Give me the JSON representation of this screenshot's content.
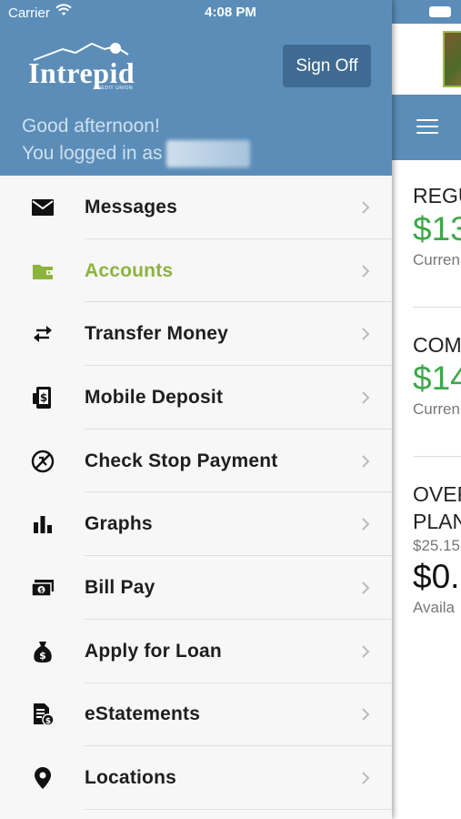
{
  "status_bar": {
    "carrier": "Carrier",
    "time": "4:08 PM"
  },
  "header": {
    "logo_text": "Intrepid",
    "logo_subtext": "CREDIT UNION",
    "sign_off_label": "Sign Off",
    "greeting": "Good afternoon!",
    "logged_in_as": "You logged in as"
  },
  "menu": {
    "items": [
      {
        "label": "Messages",
        "icon": "envelope-icon",
        "active": false
      },
      {
        "label": "Accounts",
        "icon": "wallet-icon",
        "active": true
      },
      {
        "label": "Transfer Money",
        "icon": "transfer-arrows-icon",
        "active": false
      },
      {
        "label": "Mobile Deposit",
        "icon": "mobile-deposit-icon",
        "active": false
      },
      {
        "label": "Check Stop Payment",
        "icon": "stop-payment-icon",
        "active": false
      },
      {
        "label": "Graphs",
        "icon": "bar-chart-icon",
        "active": false
      },
      {
        "label": "Bill Pay",
        "icon": "bill-icon",
        "active": false
      },
      {
        "label": "Apply for Loan",
        "icon": "money-bag-icon",
        "active": false
      },
      {
        "label": "eStatements",
        "icon": "statement-icon",
        "active": false
      },
      {
        "label": "Locations",
        "icon": "location-pin-icon",
        "active": false
      }
    ]
  },
  "background_accounts": [
    {
      "name": "REGU",
      "amount": "$13",
      "sub": "Curren"
    },
    {
      "name": "COM",
      "amount": "$14",
      "sub": "Curren"
    },
    {
      "name": "OVER",
      "name2": "PLAN",
      "extra": "$25.15",
      "amount": "$0.",
      "sub": "Availa"
    }
  ],
  "colors": {
    "header_blue": "#5b8db8",
    "button_blue": "#3f6a92",
    "active_green": "#8db33f",
    "amount_green": "#3da84a"
  }
}
